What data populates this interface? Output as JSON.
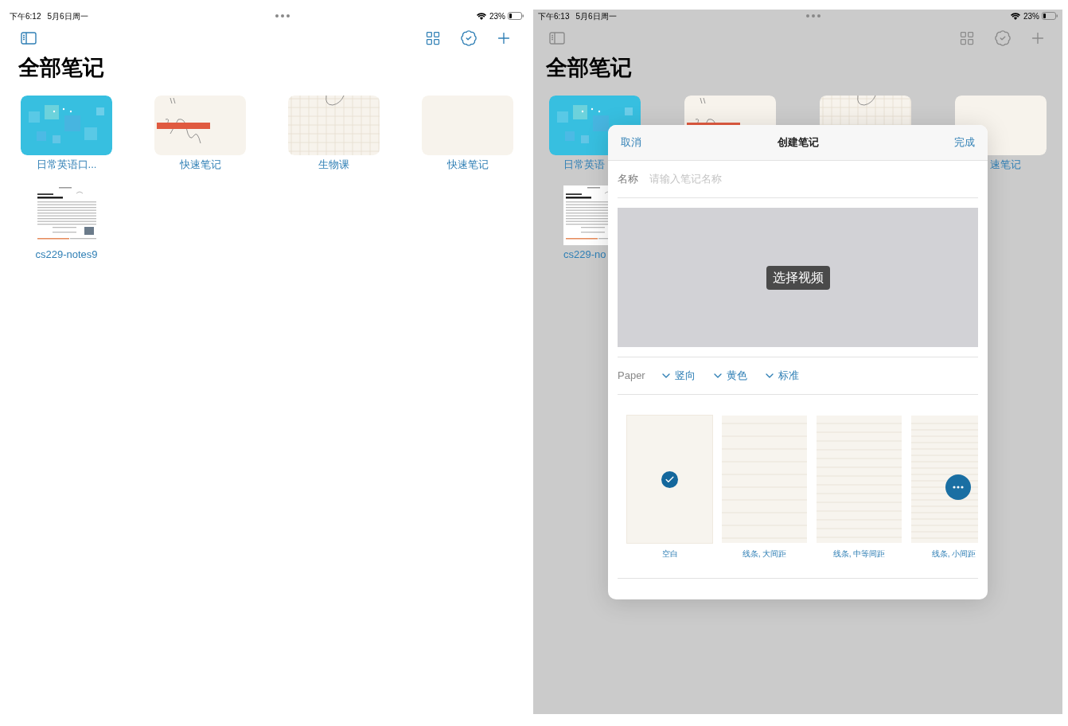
{
  "screens": [
    {
      "dimmed": false,
      "status_bar": {
        "time": "下午6:12",
        "date": "5月6日周一",
        "battery": "23%"
      },
      "title": "全部笔记",
      "notes": [
        {
          "kind": "cover",
          "label": "日常英语口..."
        },
        {
          "kind": "sketch",
          "label": "快速笔记"
        },
        {
          "kind": "grid",
          "label": "生物课"
        },
        {
          "kind": "blank",
          "label": "快速笔记"
        },
        {
          "kind": "document",
          "label": "cs229-notes9"
        }
      ]
    },
    {
      "dimmed": true,
      "status_bar": {
        "time": "下午6:13",
        "date": "5月6日周一",
        "battery": "23%"
      },
      "title": "全部笔记",
      "notes": [
        {
          "kind": "cover",
          "label": "日常英语"
        },
        {
          "kind": "sketch"
        },
        {
          "kind": "grid"
        },
        {
          "kind": "blank",
          "label": "速笔记"
        },
        {
          "kind": "document",
          "label": "cs229-no"
        }
      ],
      "dialog": {
        "cancel": "取消",
        "title": "创建笔记",
        "done": "完成",
        "name_label": "名称",
        "name_placeholder": "请输入笔记名称",
        "video_button": "选择视频",
        "paper_label": "Paper",
        "options": [
          "竖向",
          "黄色",
          "标准"
        ],
        "templates": [
          {
            "kind": "blank",
            "label": "空白",
            "selected": true
          },
          {
            "kind": "lines_large",
            "label": "线条, 大间距",
            "selected": false
          },
          {
            "kind": "lines_medium",
            "label": "线条, 中等间距",
            "selected": false
          },
          {
            "kind": "lines_small",
            "label": "线条, 小间距",
            "selected": false,
            "more": true
          }
        ]
      }
    }
  ]
}
